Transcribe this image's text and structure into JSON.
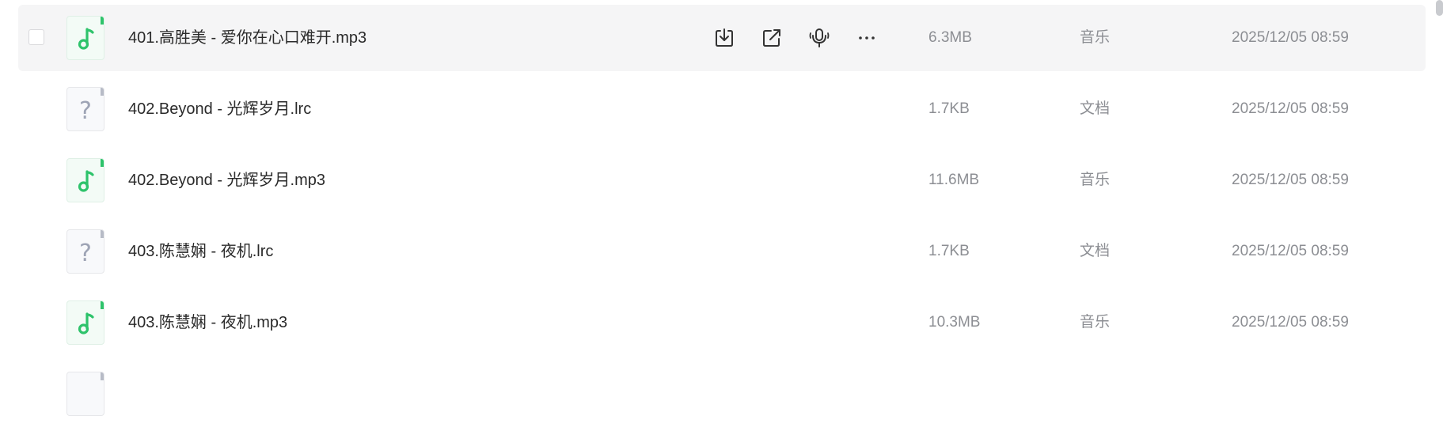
{
  "files": [
    {
      "name": "401.高胜美 - 爱你在心口难开.mp3",
      "size": "6.3MB",
      "type": "音乐",
      "time": "2025/12/05 08:59",
      "icon": "music-file-icon",
      "hovered": true
    },
    {
      "name": "402.Beyond - 光辉岁月.lrc",
      "size": "1.7KB",
      "type": "文档",
      "time": "2025/12/05 08:59",
      "icon": "unknown-file-icon",
      "hovered": false
    },
    {
      "name": "402.Beyond - 光辉岁月.mp3",
      "size": "11.6MB",
      "type": "音乐",
      "time": "2025/12/05 08:59",
      "icon": "music-file-icon",
      "hovered": false
    },
    {
      "name": "403.陈慧娴 - 夜机.lrc",
      "size": "1.7KB",
      "type": "文档",
      "time": "2025/12/05 08:59",
      "icon": "unknown-file-icon",
      "hovered": false
    },
    {
      "name": "403.陈慧娴 - 夜机.mp3",
      "size": "10.3MB",
      "type": "音乐",
      "time": "2025/12/05 08:59",
      "icon": "music-file-icon",
      "hovered": false
    }
  ],
  "row_actions": [
    {
      "name": "download",
      "icon": "download-icon"
    },
    {
      "name": "share",
      "icon": "share-icon"
    },
    {
      "name": "voice",
      "icon": "microphone-icon"
    },
    {
      "name": "more",
      "icon": "more-dots-icon"
    }
  ],
  "colors": {
    "music_accent": "#2ec36b",
    "hover_background": "#f5f5f6",
    "meta_text": "#8c8e93",
    "name_text": "#2a2a2a"
  }
}
